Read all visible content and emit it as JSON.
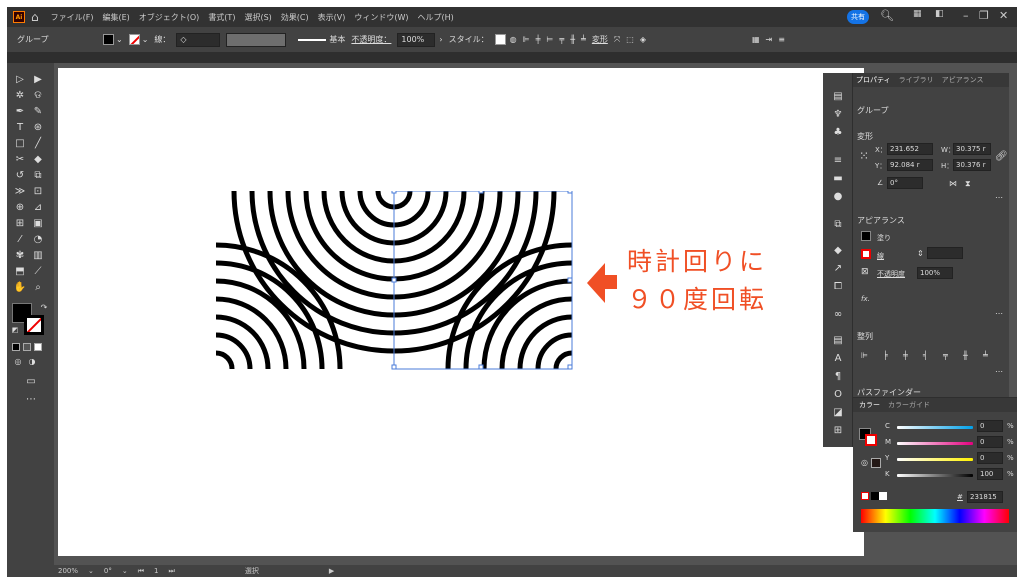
{
  "app": {
    "name": "Ai"
  },
  "menu": [
    "ファイル(F)",
    "編集(E)",
    "オブジェクト(O)",
    "書式(T)",
    "選択(S)",
    "効果(C)",
    "表示(V)",
    "ウィンドウ(W)",
    "ヘルプ(H)"
  ],
  "share": "共有",
  "control": {
    "object_type": "グループ",
    "stroke_label": "線：",
    "stroke_style": "基本",
    "opacity_label": "不透明度：",
    "opacity": "100%",
    "style_label": "スタイル：",
    "transform_label": "変形"
  },
  "properties": {
    "tabs": [
      "プロパティ",
      "ライブラリ",
      "アピアランス"
    ],
    "object_type": "グループ",
    "transform_title": "変形",
    "x_label": "X：",
    "x": "231.652",
    "y_label": "Y：",
    "y": "92.084 r",
    "w_label": "W：",
    "w": "30.375 r",
    "h_label": "H：",
    "h": "30.376 r",
    "angle": "0°",
    "appearance_title": "アピアランス",
    "fill_label": "塗り",
    "stroke_label": "線",
    "opacity_label": "不透明度",
    "opacity": "100%",
    "fx": "fx.",
    "align_title": "整列",
    "pathfinder_title": "パスファインダー"
  },
  "color": {
    "tabs": [
      "カラー",
      "カラーガイド"
    ],
    "c_label": "C",
    "c": "0",
    "m_label": "M",
    "m": "0",
    "y_label": "Y",
    "y": "0",
    "k_label": "K",
    "k": "100",
    "pct": "%",
    "hex_prefix": "#",
    "hex": "231815"
  },
  "status": {
    "zoom": "200%",
    "rotate": "0°",
    "artboard": "1",
    "tool": "選択"
  },
  "callout": {
    "line1": "時計回りに",
    "line2": "９０度回転"
  },
  "colors": {
    "accent": "#f04f25",
    "share": "#1473e6"
  }
}
